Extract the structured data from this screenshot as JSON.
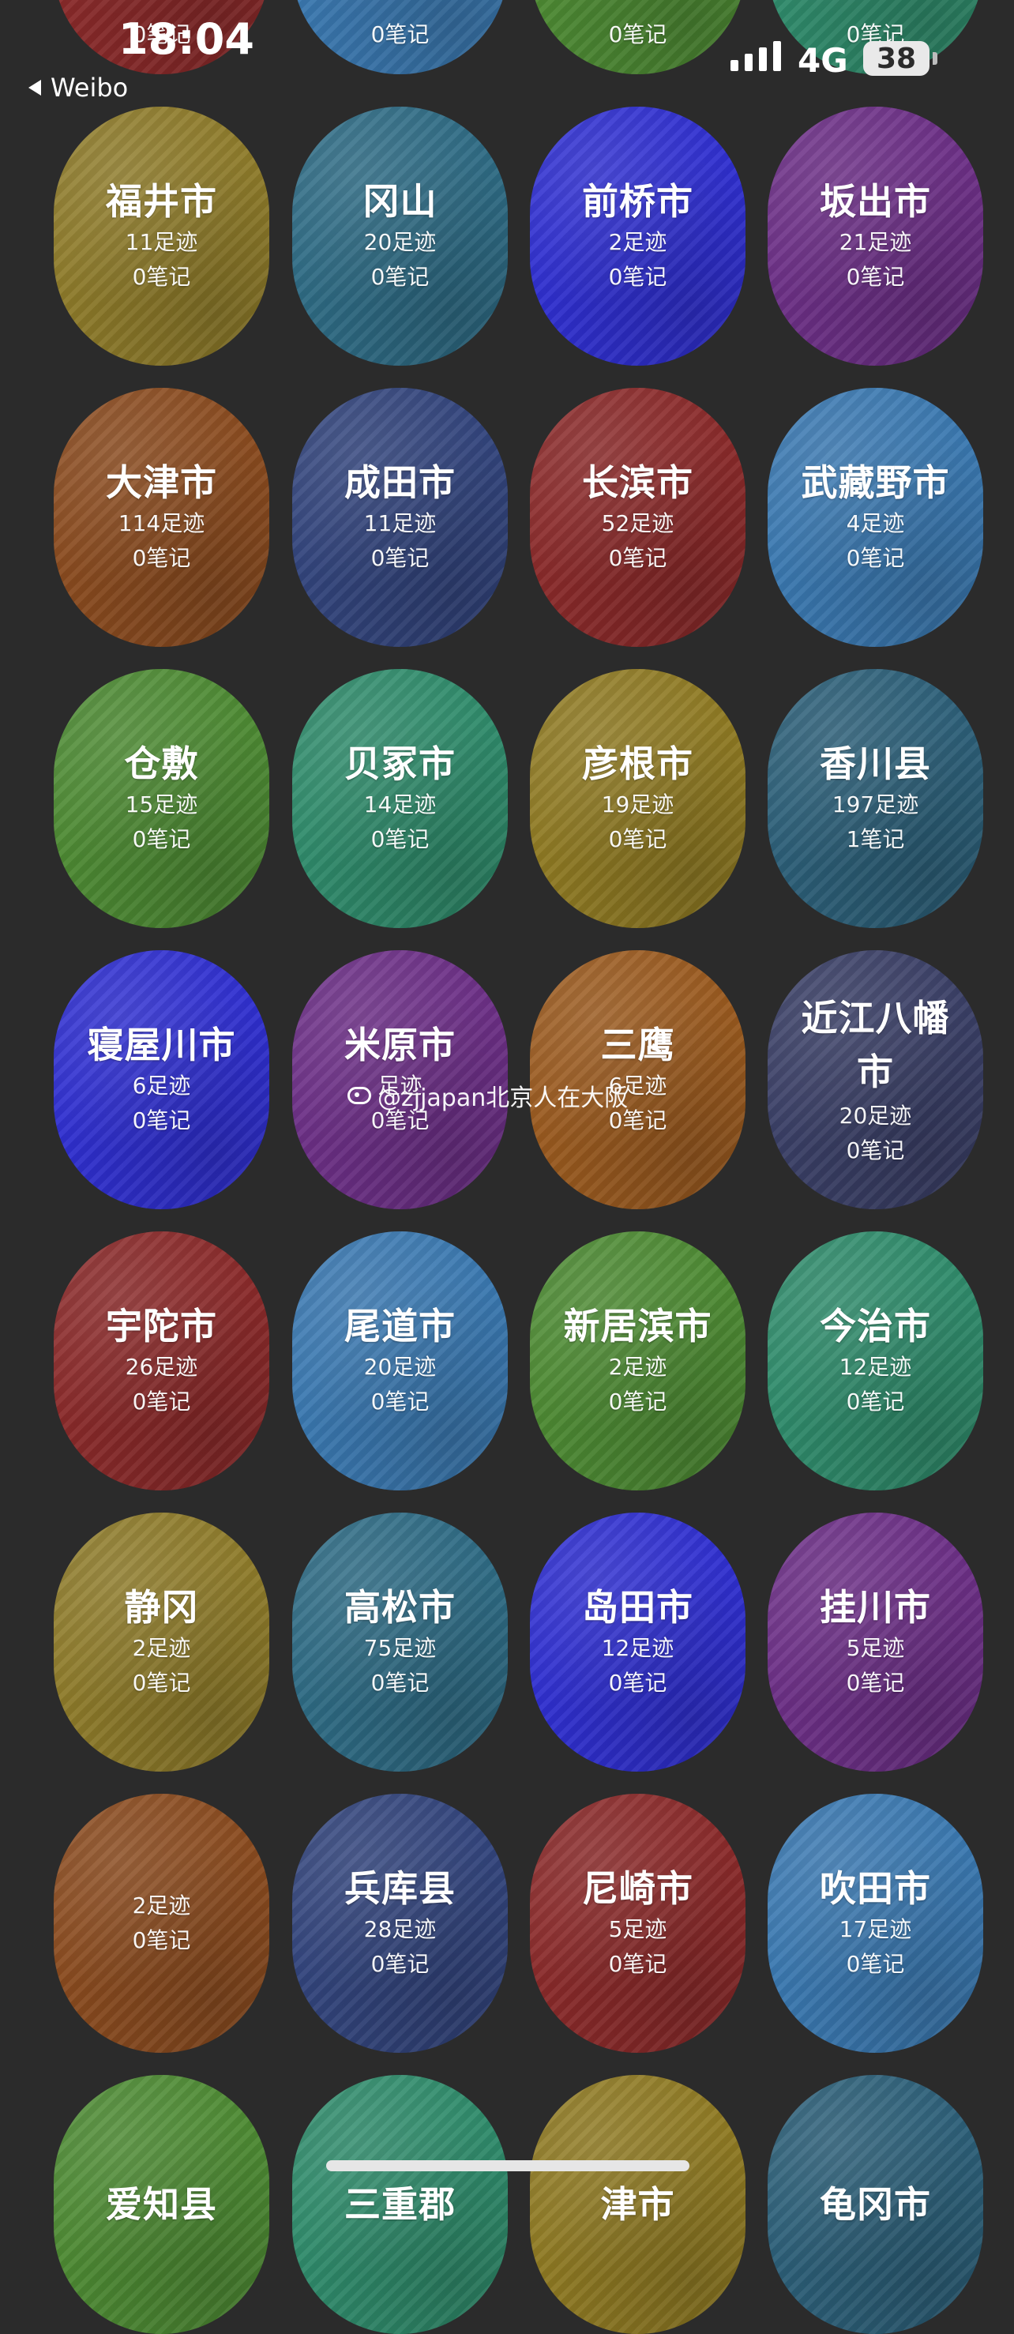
{
  "status_bar": {
    "time": "18:04",
    "back_label": "Weibo",
    "network": "4G",
    "battery": "38"
  },
  "watermark": "@zjjapan北京人在大阪",
  "colors": {
    "olive": "#8e7b2a",
    "teal": "#2e6b84",
    "indigo": "#2f2fd0",
    "purple": "#6c2f86",
    "brown": "#8a4b1f",
    "navy": "#32447c",
    "red": "#8a2a2a",
    "sky": "#3a78b0",
    "green": "#4d8a33",
    "jade": "#2f8b6b",
    "gold": "#8f7a23",
    "steel": "#2c5f78",
    "slate": "#3a3f66",
    "orange": "#9a5a1f"
  },
  "top_partial_row": [
    {
      "subtitle": "0笔记",
      "color": "red"
    },
    {
      "subtitle": "0笔记",
      "color": "sky"
    },
    {
      "subtitle": "0笔记",
      "color": "green"
    },
    {
      "subtitle": "0笔记",
      "color": "jade"
    }
  ],
  "cities": [
    {
      "name": "福井市",
      "footprints": "11足迹",
      "notes": "0笔记",
      "color": "olive"
    },
    {
      "name": "冈山",
      "footprints": "20足迹",
      "notes": "0笔记",
      "color": "teal"
    },
    {
      "name": "前桥市",
      "footprints": "2足迹",
      "notes": "0笔记",
      "color": "indigo"
    },
    {
      "name": "坂出市",
      "footprints": "21足迹",
      "notes": "0笔记",
      "color": "purple"
    },
    {
      "name": "大津市",
      "footprints": "114足迹",
      "notes": "0笔记",
      "color": "brown"
    },
    {
      "name": "成田市",
      "footprints": "11足迹",
      "notes": "0笔记",
      "color": "navy"
    },
    {
      "name": "长滨市",
      "footprints": "52足迹",
      "notes": "0笔记",
      "color": "red"
    },
    {
      "name": "武藏野市",
      "footprints": "4足迹",
      "notes": "0笔记",
      "color": "sky"
    },
    {
      "name": "仓敷",
      "footprints": "15足迹",
      "notes": "0笔记",
      "color": "green"
    },
    {
      "name": "贝冢市",
      "footprints": "14足迹",
      "notes": "0笔记",
      "color": "jade"
    },
    {
      "name": "彦根市",
      "footprints": "19足迹",
      "notes": "0笔记",
      "color": "gold"
    },
    {
      "name": "香川县",
      "footprints": "197足迹",
      "notes": "1笔记",
      "color": "steel"
    },
    {
      "name": "寝屋川市",
      "footprints": "6足迹",
      "notes": "0笔记",
      "color": "indigo"
    },
    {
      "name": "米原市",
      "footprints": "足迹",
      "notes": "0笔记",
      "color": "purple"
    },
    {
      "name": "三鹰",
      "footprints": "6足迹",
      "notes": "0笔记",
      "color": "orange"
    },
    {
      "name": "近江八幡市",
      "footprints": "20足迹",
      "notes": "0笔记",
      "color": "slate"
    },
    {
      "name": "宇陀市",
      "footprints": "26足迹",
      "notes": "0笔记",
      "color": "red"
    },
    {
      "name": "尾道市",
      "footprints": "20足迹",
      "notes": "0笔记",
      "color": "sky"
    },
    {
      "name": "新居滨市",
      "footprints": "2足迹",
      "notes": "0笔记",
      "color": "green"
    },
    {
      "name": "今治市",
      "footprints": "12足迹",
      "notes": "0笔记",
      "color": "jade"
    },
    {
      "name": "静冈",
      "footprints": "2足迹",
      "notes": "0笔记",
      "color": "olive"
    },
    {
      "name": "高松市",
      "footprints": "75足迹",
      "notes": "0笔记",
      "color": "teal"
    },
    {
      "name": "岛田市",
      "footprints": "12足迹",
      "notes": "0笔记",
      "color": "indigo"
    },
    {
      "name": "挂川市",
      "footprints": "5足迹",
      "notes": "0笔记",
      "color": "purple"
    },
    {
      "name": "",
      "footprints": "2足迹",
      "notes": "0笔记",
      "color": "brown"
    },
    {
      "name": "兵库县",
      "footprints": "28足迹",
      "notes": "0笔记",
      "color": "navy"
    },
    {
      "name": "尼崎市",
      "footprints": "5足迹",
      "notes": "0笔记",
      "color": "red"
    },
    {
      "name": "吹田市",
      "footprints": "17足迹",
      "notes": "0笔记",
      "color": "sky"
    },
    {
      "name": "爱知县",
      "footprints": "",
      "notes": "",
      "color": "green"
    },
    {
      "name": "三重郡",
      "footprints": "",
      "notes": "",
      "color": "jade"
    },
    {
      "name": "津市",
      "footprints": "",
      "notes": "",
      "color": "gold"
    },
    {
      "name": "龟冈市",
      "footprints": "",
      "notes": "",
      "color": "steel"
    }
  ]
}
